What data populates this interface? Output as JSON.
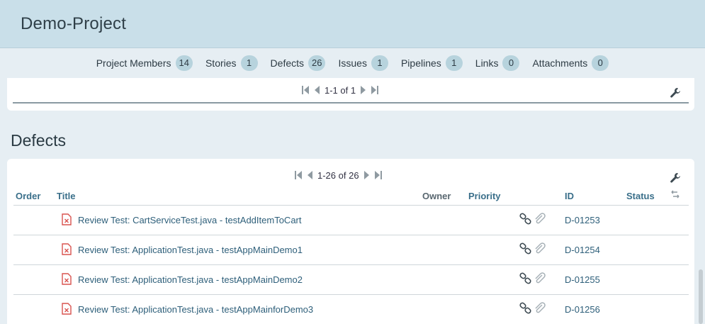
{
  "header": {
    "title": "Demo-Project"
  },
  "tabs": [
    {
      "label": "Project Members",
      "count": "14"
    },
    {
      "label": "Stories",
      "count": "1"
    },
    {
      "label": "Defects",
      "count": "26"
    },
    {
      "label": "Issues",
      "count": "1"
    },
    {
      "label": "Pipelines",
      "count": "1"
    },
    {
      "label": "Links",
      "count": "0"
    },
    {
      "label": "Attachments",
      "count": "0"
    }
  ],
  "top_panel": {
    "pager_text": "1-1 of 1"
  },
  "defects": {
    "section_title": "Defects",
    "pager_text": "1-26 of 26",
    "columns": {
      "order": "Order",
      "title": "Title",
      "owner": "Owner",
      "priority": "Priority",
      "id": "ID",
      "status": "Status"
    },
    "rows": [
      {
        "title": "Review Test: CartServiceTest.java - testAddItemToCart",
        "id": "D-01253"
      },
      {
        "title": "Review Test: ApplicationTest.java - testAppMainDemo1",
        "id": "D-01254"
      },
      {
        "title": "Review Test: ApplicationTest.java - testAppMainDemo2",
        "id": "D-01255"
      },
      {
        "title": "Review Test: ApplicationTest.java - testAppMainforDemo3",
        "id": "D-01256"
      }
    ]
  },
  "icons": {
    "pager": [
      "first-page-icon",
      "prev-page-icon",
      "next-page-icon",
      "last-page-icon"
    ],
    "tools": "wrench-icon",
    "row": [
      "defect-doc-icon",
      "link-icon",
      "paperclip-icon"
    ],
    "sort": "sort-icon"
  },
  "colors": {
    "header_bg": "#c9dfe9",
    "badge_bg": "#b7d3dd",
    "link": "#2e5f7a",
    "column_header": "#3a6f8a",
    "doc_icon": "#d9534f"
  }
}
